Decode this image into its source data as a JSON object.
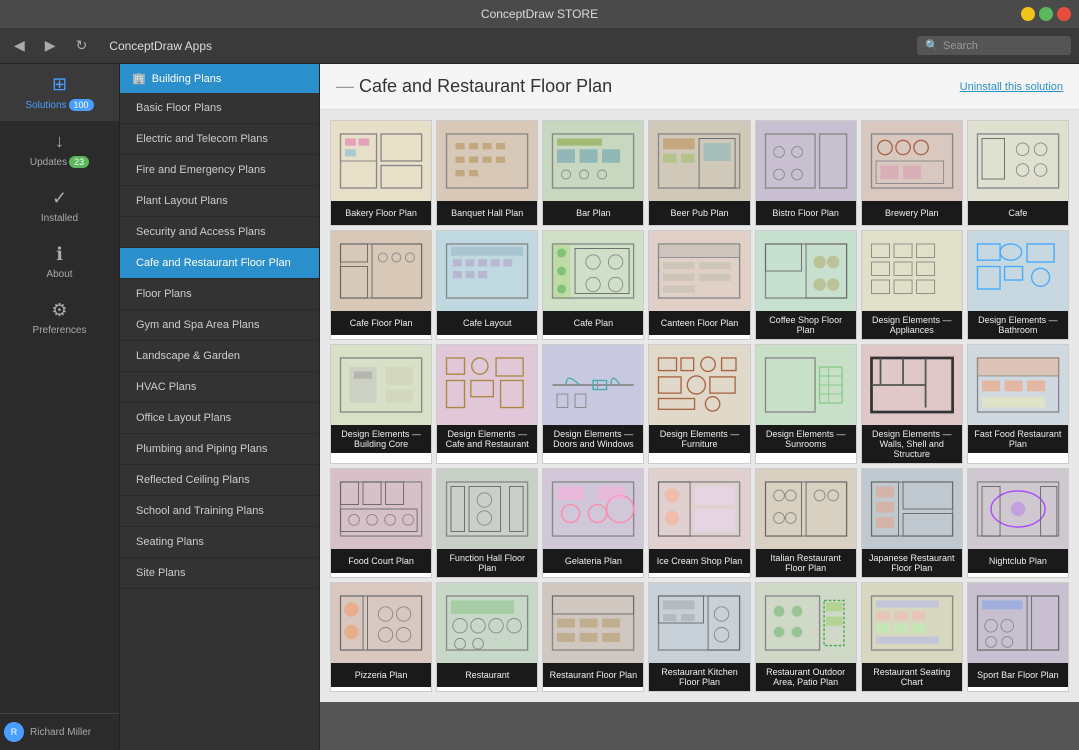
{
  "window": {
    "title": "ConceptDraw STORE"
  },
  "toolbar": {
    "back_label": "◀",
    "forward_label": "▶",
    "refresh_label": "↻",
    "app_title": "ConceptDraw Apps",
    "search_placeholder": "Search"
  },
  "sidebar": {
    "items": [
      {
        "id": "solutions",
        "label": "Solutions",
        "icon": "⊞",
        "badge": "100",
        "badge_color": "blue",
        "active": true
      },
      {
        "id": "updates",
        "label": "Updates",
        "icon": "↓",
        "badge": "23",
        "badge_color": "green"
      },
      {
        "id": "installed",
        "label": "Installed",
        "icon": "✓"
      },
      {
        "id": "about",
        "label": "About",
        "icon": "ℹ"
      },
      {
        "id": "preferences",
        "label": "Preferences",
        "icon": "⚙"
      }
    ],
    "user": {
      "name": "Richard Miller",
      "avatar": "R"
    }
  },
  "nav_panel": {
    "header": "Building Plans",
    "items": [
      {
        "label": "Basic Floor Plans",
        "active": false
      },
      {
        "label": "Electric and Telecom Plans",
        "active": false
      },
      {
        "label": "Fire and Emergency Plans",
        "active": false
      },
      {
        "label": "Plant Layout Plans",
        "active": false
      },
      {
        "label": "Security and Access Plans",
        "active": false
      },
      {
        "label": "Cafe and Restaurant Floor Plan",
        "active": true
      },
      {
        "label": "Floor Plans",
        "active": false
      },
      {
        "label": "Gym and Spa Area Plans",
        "active": false
      },
      {
        "label": "Landscape & Garden",
        "active": false
      },
      {
        "label": "HVAC Plans",
        "active": false
      },
      {
        "label": "Office Layout Plans",
        "active": false
      },
      {
        "label": "Plumbing and Piping Plans",
        "active": false
      },
      {
        "label": "Reflected Ceiling Plans",
        "active": false
      },
      {
        "label": "School and Training Plans",
        "active": false
      },
      {
        "label": "Seating Plans",
        "active": false
      },
      {
        "label": "Site Plans",
        "active": false
      }
    ]
  },
  "content": {
    "title": "Cafe and Restaurant Floor Plan",
    "uninstall_label": "Uninstall this solution",
    "grid_items": [
      {
        "label": "Bakery Floor Plan",
        "bg": "#e8dfc8",
        "pattern": "bakery"
      },
      {
        "label": "Banquet Hall Plan",
        "bg": "#d8c8b8",
        "pattern": "banquet"
      },
      {
        "label": "Bar Plan",
        "bg": "#c8d8c0",
        "pattern": "bar"
      },
      {
        "label": "Beer Pub Plan",
        "bg": "#d0c8b8",
        "pattern": "beer"
      },
      {
        "label": "Bistro Floor Plan",
        "bg": "#c8c0d0",
        "pattern": "bistro"
      },
      {
        "label": "Brewery Plan",
        "bg": "#d8c8c0",
        "pattern": "brewery"
      },
      {
        "label": "Cafe",
        "bg": "#e0e0d0",
        "pattern": "cafe"
      },
      {
        "label": "Cafe Floor Plan",
        "bg": "#d8c8b8",
        "pattern": "cafe-floor"
      },
      {
        "label": "Cafe Layout",
        "bg": "#c0d8e0",
        "pattern": "cafe-layout"
      },
      {
        "label": "Cafe Plan",
        "bg": "#d0e0c8",
        "pattern": "cafe-plan"
      },
      {
        "label": "Canteen Floor Plan",
        "bg": "#e0d0c8",
        "pattern": "canteen"
      },
      {
        "label": "Coffee Shop Floor Plan",
        "bg": "#c8e0d0",
        "pattern": "coffee"
      },
      {
        "label": "Design Elements — Appliances",
        "bg": "#e0e0c8",
        "pattern": "design-appliances"
      },
      {
        "label": "Design Elements — Bathroom",
        "bg": "#c8d8e0",
        "pattern": "design-bathroom"
      },
      {
        "label": "Design Elements — Building Core",
        "bg": "#d8e0c8",
        "pattern": "design-core"
      },
      {
        "label": "Design Elements — Cafe and Restaurant",
        "bg": "#e0c8d8",
        "pattern": "design-cafe"
      },
      {
        "label": "Design Elements — Doors and Windows",
        "bg": "#c8c8e0",
        "pattern": "design-doors"
      },
      {
        "label": "Design Elements — Furniture",
        "bg": "#e0d8c8",
        "pattern": "design-furniture"
      },
      {
        "label": "Design Elements — Sunrooms",
        "bg": "#c8e0c8",
        "pattern": "design-sunrooms"
      },
      {
        "label": "Design Elements — Walls, Shell and Structure",
        "bg": "#e0c8c8",
        "pattern": "design-walls"
      },
      {
        "label": "Fast Food Restaurant Plan",
        "bg": "#d0d8e0",
        "pattern": "fastfood"
      },
      {
        "label": "Food Court Plan",
        "bg": "#d8c0c8",
        "pattern": "foodcourt"
      },
      {
        "label": "Function Hall Floor Plan",
        "bg": "#c8d0c8",
        "pattern": "functionhall"
      },
      {
        "label": "Gelateria Plan",
        "bg": "#d0c8d8",
        "pattern": "gelateria"
      },
      {
        "label": "Ice Cream Shop Plan",
        "bg": "#e0d0d0",
        "pattern": "icecream"
      },
      {
        "label": "Italian Restaurant Floor Plan",
        "bg": "#d8d0c0",
        "pattern": "italian"
      },
      {
        "label": "Japanese Restaurant Floor Plan",
        "bg": "#c0c8d0",
        "pattern": "japanese"
      },
      {
        "label": "Nightclub Plan",
        "bg": "#d0c8d0",
        "pattern": "nightclub"
      },
      {
        "label": "Pizzeria Plan",
        "bg": "#d8c8c0",
        "pattern": "pizzeria"
      },
      {
        "label": "Restaurant",
        "bg": "#c8d8c8",
        "pattern": "restaurant"
      },
      {
        "label": "Restaurant Floor Plan",
        "bg": "#d0c8c0",
        "pattern": "restaurant-floor"
      },
      {
        "label": "Restaurant Kitchen Floor Plan",
        "bg": "#c8d0d8",
        "pattern": "restaurant-kitchen"
      },
      {
        "label": "Restaurant Outdoor Area, Patio Plan",
        "bg": "#d0d8c8",
        "pattern": "restaurant-outdoor"
      },
      {
        "label": "Restaurant Seating Chart",
        "bg": "#d8d8c0",
        "pattern": "restaurant-seating"
      },
      {
        "label": "Sport Bar Floor Plan",
        "bg": "#c8c0d0",
        "pattern": "sportbar"
      }
    ]
  }
}
